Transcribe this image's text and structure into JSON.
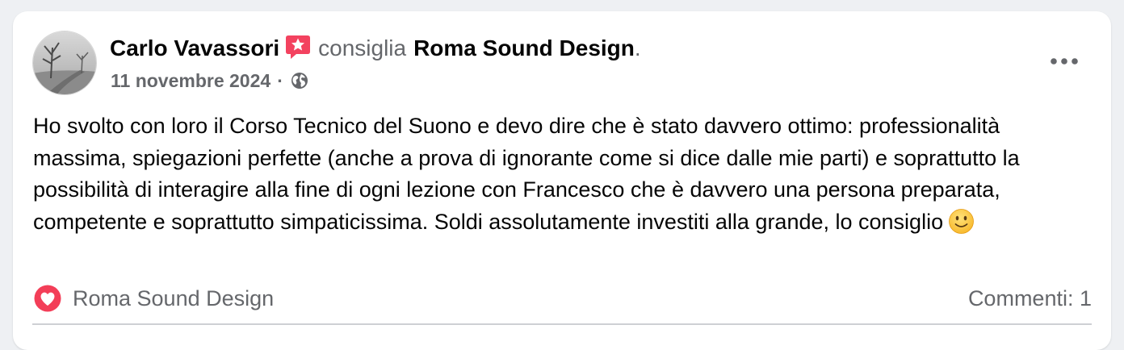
{
  "post": {
    "author": "Carlo Vavassori",
    "verb": "consiglia",
    "page": "Roma Sound Design",
    "page_suffix": ".",
    "date": "11 novembre 2024",
    "separator": "·",
    "privacy_icon": "globe-icon",
    "more_icon": "more-options-icon",
    "recommend_icon": "recommend-star-icon",
    "text": "Ho svolto con loro il Corso Tecnico del Suono e devo dire che è stato davvero ottimo: professionalità massima, spiegazioni perfette (anche a prova di ignorante come si dice dalle mie parti) e soprattutto la possibilità di interagire alla fine di ogni lezione con Francesco che è davvero una persona preparata, competente e soprattutto simpaticissima. Soldi assolutamente investiti alla grande, lo consiglio",
    "emoji": "smiling-face-emoji"
  },
  "footer": {
    "reaction_icon": "love-reaction-icon",
    "reaction_name": "Roma Sound Design",
    "comments": "Commenti: 1"
  },
  "colors": {
    "recommend_red": "#f3425f",
    "love_red": "#f33e58",
    "secondary_text": "#65676b",
    "primary_text": "#050505"
  }
}
